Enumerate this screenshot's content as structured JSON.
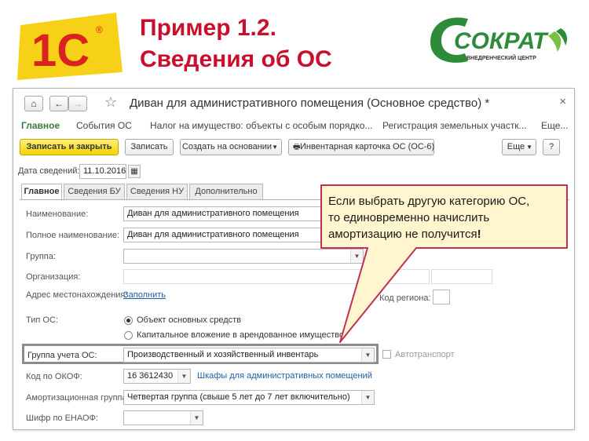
{
  "slide": {
    "title_line1": "Пример 1.2.",
    "title_line2": "Сведения об ОС",
    "logo_left_text": "1С",
    "logo_left_mark": "®",
    "logo_right_text": "СОКРАТ",
    "logo_right_sub": "ВНЕДРЕНЧЕСКИЙ ЦЕНТР"
  },
  "window": {
    "title": "Диван для административного помещения (Основное средство) *",
    "close_glyph": "×",
    "home_glyph": "⌂",
    "back_glyph": "←",
    "forward_glyph": "→",
    "star_glyph": "☆"
  },
  "navbar": {
    "items": [
      "Главное",
      "События ОС",
      "Налог на имущество: объекты с особым порядко...",
      "Регистрация земельных участк...",
      "Еще..."
    ]
  },
  "toolbar": {
    "save_close": "Записать и закрыть",
    "save": "Записать",
    "create_based": "Создать на основании",
    "inventory_card": "Инвентарная карточка ОС (ОС-6)",
    "more": "Еще",
    "help": "?"
  },
  "date": {
    "label": "Дата сведений:",
    "value": "11.10.2016"
  },
  "tabs": [
    "Главное",
    "Сведения БУ",
    "Сведения НУ",
    "Дополнительно"
  ],
  "form": {
    "name_label": "Наименование:",
    "name_value": "Диван для административного помещения",
    "fullname_label": "Полное наименование:",
    "fullname_value": "Диван для административного помещения",
    "group_label": "Группа:",
    "group_value": "",
    "org_label": "Организация:",
    "address_label": "Адрес местонахождения:",
    "address_link": "Заполнить",
    "region_label": "Код региона:",
    "type_label": "Тип ОС:",
    "type_option1": "Объект основных средств",
    "type_option2": "Капитальное вложение в арендованное имущество",
    "acc_group_label": "Группа учета ОС:",
    "acc_group_value": "Производственный и хозяйственный инвентарь",
    "auto_label": "Автотранспорт",
    "okof_label": "Код по ОКОФ:",
    "okof_value": "16 3612430",
    "okof_link": "Шкафы для административных помещений",
    "amort_label": "Амортизационная группа:",
    "amort_value": "Четвертая группа (свыше 5 лет до 7 лет включительно)",
    "enaof_label": "Шифр по ЕНАОФ:",
    "enaof_value": ""
  },
  "callout": {
    "line1": "Если выбрать другую категорию ОС,",
    "line2": "то единовременно начислить",
    "line3": "амортизацию не получится",
    "bang": "!"
  },
  "colors": {
    "title_red": "#c8102e",
    "primary_button": "#f5d300",
    "callout_fill": "#fff6d0",
    "callout_border": "#c03050",
    "logo_green": "#2e8b3a"
  }
}
